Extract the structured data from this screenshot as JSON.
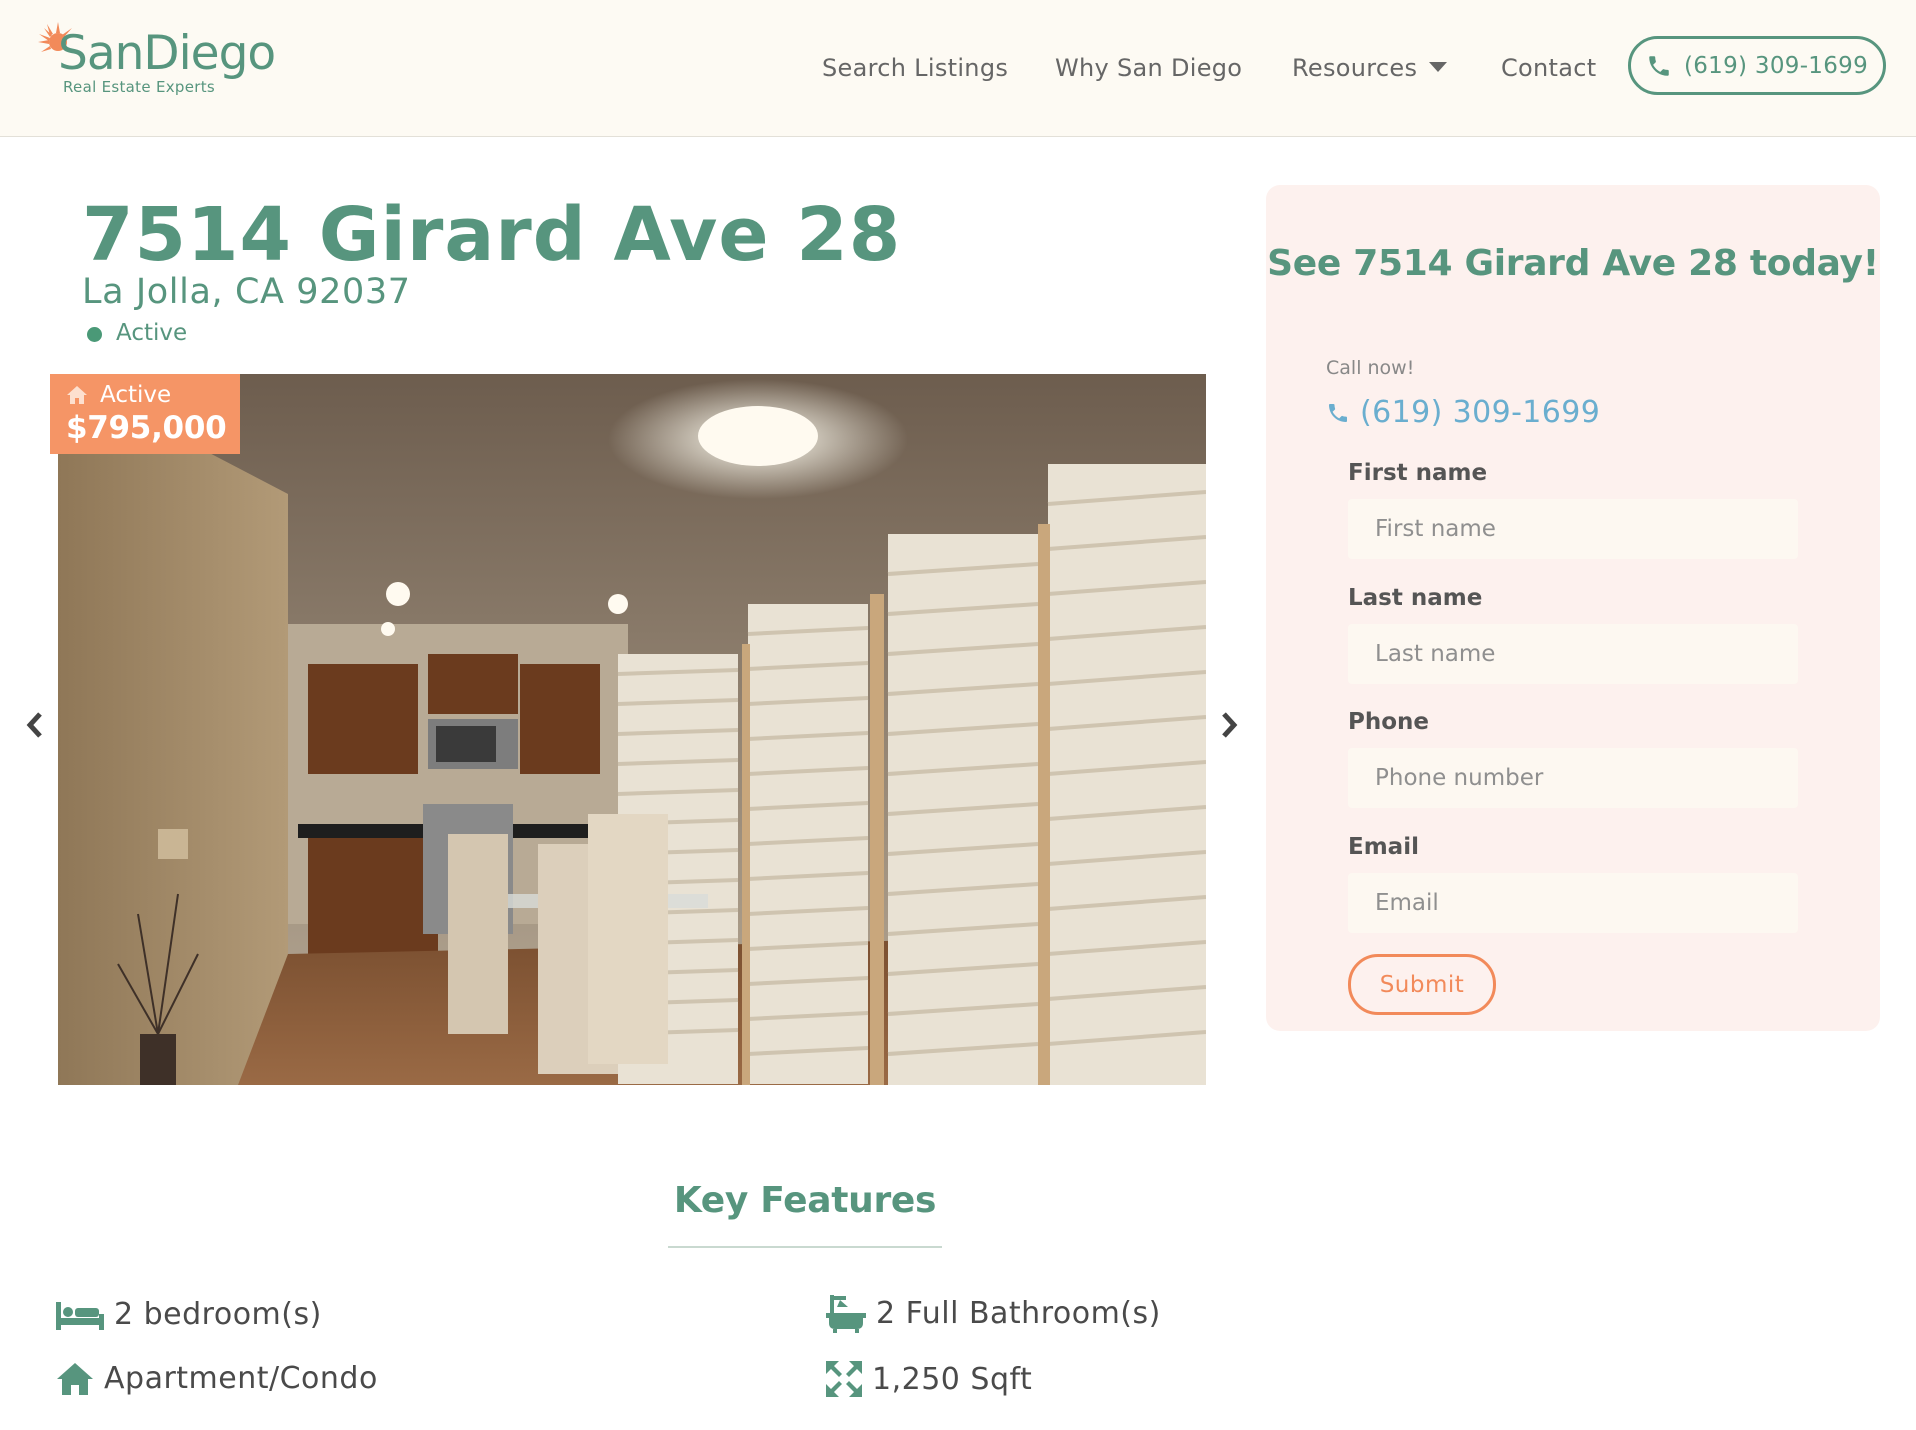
{
  "header": {
    "logo_name": "SanDiego",
    "logo_tagline": "Real Estate Experts",
    "nav": {
      "search": "Search Listings",
      "why": "Why San Diego",
      "resources": "Resources",
      "contact": "Contact"
    },
    "phone": "(619) 309-1699"
  },
  "listing": {
    "address": "7514 Girard Ave 28",
    "city_line": "La Jolla, CA 92037",
    "status": "Active",
    "price_tag_status": "Active",
    "price": "$795,000"
  },
  "contact_card": {
    "title": "See 7514 Girard Ave 28 today!",
    "call_label": "Call now!",
    "call_number": "(619) 309-1699",
    "fields": {
      "first_name": {
        "label": "First name",
        "placeholder": "First name"
      },
      "last_name": {
        "label": "Last name",
        "placeholder": "Last name"
      },
      "phone": {
        "label": "Phone",
        "placeholder": "Phone number"
      },
      "email": {
        "label": "Email",
        "placeholder": "Email"
      }
    },
    "submit": "Submit"
  },
  "key_features": {
    "title": "Key Features",
    "bedrooms": "2 bedroom(s)",
    "bathrooms": "2 Full Bathroom(s)",
    "type": "Apartment/Condo",
    "size": "1,250 Sqft"
  },
  "colors": {
    "brand_green": "#57957e",
    "accent_orange": "#f59566",
    "link_blue": "#6aaecf",
    "header_bg": "#fdfaf3",
    "card_bg": "#fdf1ee"
  },
  "icons": {
    "logo": "sun-logo-icon",
    "phone": "phone-icon",
    "home": "home-icon",
    "bed": "bed-icon",
    "bath": "bath-icon",
    "expand": "expand-icon",
    "prev": "chevron-left-icon",
    "next": "chevron-right-icon"
  }
}
